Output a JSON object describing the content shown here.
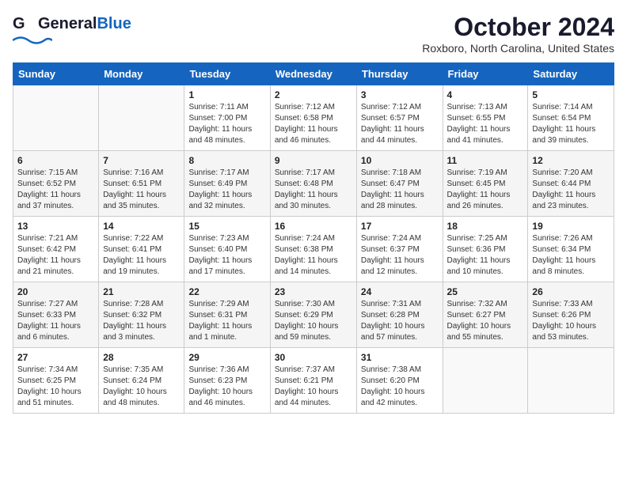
{
  "header": {
    "logo_general": "General",
    "logo_blue": "Blue",
    "month_title": "October 2024",
    "location": "Roxboro, North Carolina, United States"
  },
  "weekdays": [
    "Sunday",
    "Monday",
    "Tuesday",
    "Wednesday",
    "Thursday",
    "Friday",
    "Saturday"
  ],
  "weeks": [
    [
      {
        "day": "",
        "info": ""
      },
      {
        "day": "",
        "info": ""
      },
      {
        "day": "1",
        "info": "Sunrise: 7:11 AM\nSunset: 7:00 PM\nDaylight: 11 hours\nand 48 minutes."
      },
      {
        "day": "2",
        "info": "Sunrise: 7:12 AM\nSunset: 6:58 PM\nDaylight: 11 hours\nand 46 minutes."
      },
      {
        "day": "3",
        "info": "Sunrise: 7:12 AM\nSunset: 6:57 PM\nDaylight: 11 hours\nand 44 minutes."
      },
      {
        "day": "4",
        "info": "Sunrise: 7:13 AM\nSunset: 6:55 PM\nDaylight: 11 hours\nand 41 minutes."
      },
      {
        "day": "5",
        "info": "Sunrise: 7:14 AM\nSunset: 6:54 PM\nDaylight: 11 hours\nand 39 minutes."
      }
    ],
    [
      {
        "day": "6",
        "info": "Sunrise: 7:15 AM\nSunset: 6:52 PM\nDaylight: 11 hours\nand 37 minutes."
      },
      {
        "day": "7",
        "info": "Sunrise: 7:16 AM\nSunset: 6:51 PM\nDaylight: 11 hours\nand 35 minutes."
      },
      {
        "day": "8",
        "info": "Sunrise: 7:17 AM\nSunset: 6:49 PM\nDaylight: 11 hours\nand 32 minutes."
      },
      {
        "day": "9",
        "info": "Sunrise: 7:17 AM\nSunset: 6:48 PM\nDaylight: 11 hours\nand 30 minutes."
      },
      {
        "day": "10",
        "info": "Sunrise: 7:18 AM\nSunset: 6:47 PM\nDaylight: 11 hours\nand 28 minutes."
      },
      {
        "day": "11",
        "info": "Sunrise: 7:19 AM\nSunset: 6:45 PM\nDaylight: 11 hours\nand 26 minutes."
      },
      {
        "day": "12",
        "info": "Sunrise: 7:20 AM\nSunset: 6:44 PM\nDaylight: 11 hours\nand 23 minutes."
      }
    ],
    [
      {
        "day": "13",
        "info": "Sunrise: 7:21 AM\nSunset: 6:42 PM\nDaylight: 11 hours\nand 21 minutes."
      },
      {
        "day": "14",
        "info": "Sunrise: 7:22 AM\nSunset: 6:41 PM\nDaylight: 11 hours\nand 19 minutes."
      },
      {
        "day": "15",
        "info": "Sunrise: 7:23 AM\nSunset: 6:40 PM\nDaylight: 11 hours\nand 17 minutes."
      },
      {
        "day": "16",
        "info": "Sunrise: 7:24 AM\nSunset: 6:38 PM\nDaylight: 11 hours\nand 14 minutes."
      },
      {
        "day": "17",
        "info": "Sunrise: 7:24 AM\nSunset: 6:37 PM\nDaylight: 11 hours\nand 12 minutes."
      },
      {
        "day": "18",
        "info": "Sunrise: 7:25 AM\nSunset: 6:36 PM\nDaylight: 11 hours\nand 10 minutes."
      },
      {
        "day": "19",
        "info": "Sunrise: 7:26 AM\nSunset: 6:34 PM\nDaylight: 11 hours\nand 8 minutes."
      }
    ],
    [
      {
        "day": "20",
        "info": "Sunrise: 7:27 AM\nSunset: 6:33 PM\nDaylight: 11 hours\nand 6 minutes."
      },
      {
        "day": "21",
        "info": "Sunrise: 7:28 AM\nSunset: 6:32 PM\nDaylight: 11 hours\nand 3 minutes."
      },
      {
        "day": "22",
        "info": "Sunrise: 7:29 AM\nSunset: 6:31 PM\nDaylight: 11 hours\nand 1 minute."
      },
      {
        "day": "23",
        "info": "Sunrise: 7:30 AM\nSunset: 6:29 PM\nDaylight: 10 hours\nand 59 minutes."
      },
      {
        "day": "24",
        "info": "Sunrise: 7:31 AM\nSunset: 6:28 PM\nDaylight: 10 hours\nand 57 minutes."
      },
      {
        "day": "25",
        "info": "Sunrise: 7:32 AM\nSunset: 6:27 PM\nDaylight: 10 hours\nand 55 minutes."
      },
      {
        "day": "26",
        "info": "Sunrise: 7:33 AM\nSunset: 6:26 PM\nDaylight: 10 hours\nand 53 minutes."
      }
    ],
    [
      {
        "day": "27",
        "info": "Sunrise: 7:34 AM\nSunset: 6:25 PM\nDaylight: 10 hours\nand 51 minutes."
      },
      {
        "day": "28",
        "info": "Sunrise: 7:35 AM\nSunset: 6:24 PM\nDaylight: 10 hours\nand 48 minutes."
      },
      {
        "day": "29",
        "info": "Sunrise: 7:36 AM\nSunset: 6:23 PM\nDaylight: 10 hours\nand 46 minutes."
      },
      {
        "day": "30",
        "info": "Sunrise: 7:37 AM\nSunset: 6:21 PM\nDaylight: 10 hours\nand 44 minutes."
      },
      {
        "day": "31",
        "info": "Sunrise: 7:38 AM\nSunset: 6:20 PM\nDaylight: 10 hours\nand 42 minutes."
      },
      {
        "day": "",
        "info": ""
      },
      {
        "day": "",
        "info": ""
      }
    ]
  ]
}
